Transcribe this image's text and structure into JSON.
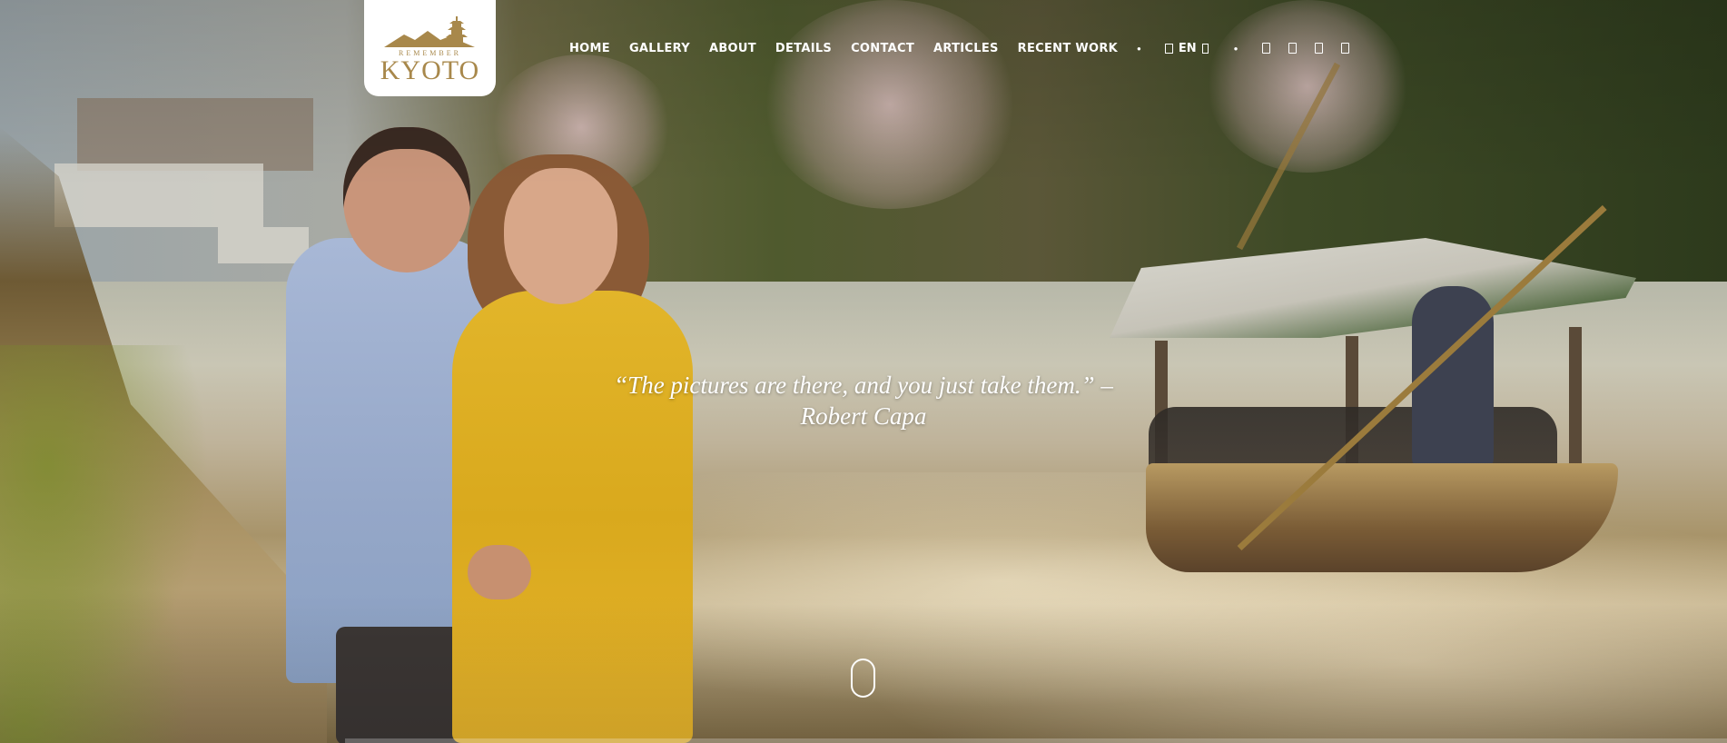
{
  "logo": {
    "top_text": "REMEMBER",
    "main_text": "KYOTO",
    "brand_color": "#a8884b"
  },
  "nav": {
    "items": [
      {
        "label": "HOME"
      },
      {
        "label": "GALLERY"
      },
      {
        "label": "ABOUT"
      },
      {
        "label": "DETAILS"
      },
      {
        "label": "CONTACT"
      },
      {
        "label": "ARTICLES"
      },
      {
        "label": "RECENT WORK"
      }
    ],
    "language": {
      "label": "EN",
      "icon": "globe-icon",
      "caret_icon": "chevron-down-icon"
    },
    "social_icons": [
      "facebook-icon",
      "instagram-icon",
      "twitter-icon",
      "pinterest-icon"
    ]
  },
  "hero": {
    "quote_line1": "“The pictures are there, and you just take them.” –",
    "quote_line2": "Robert Capa",
    "scroll_icon": "mouse-scroll-icon"
  },
  "colors": {
    "nav_text": "#ffffff",
    "dress": "#e2b52a"
  }
}
